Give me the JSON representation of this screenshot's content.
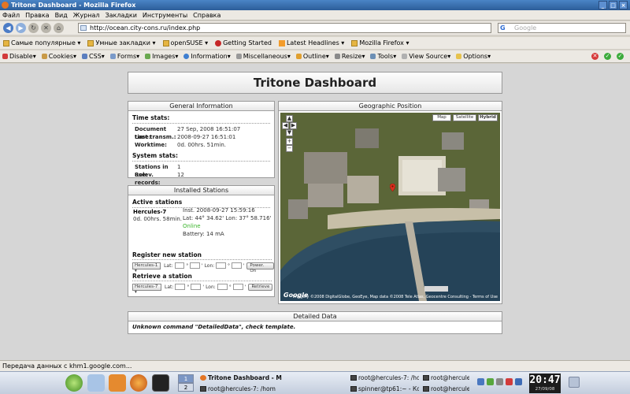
{
  "window": {
    "title": "Tritone Dashboard - Mozilla Firefox"
  },
  "menubar": [
    "Файл",
    "Правка",
    "Вид",
    "Журнал",
    "Закладки",
    "Инструменты",
    "Справка"
  ],
  "navbar": {
    "url": "http://ocean.city-cons.ru/index.php",
    "search_placeholder": "Google"
  },
  "bookmarks": [
    {
      "label": "Самые популярные",
      "icon": "folder-icon"
    },
    {
      "label": "Умные закладки",
      "icon": "folder-icon"
    },
    {
      "label": "openSUSE",
      "icon": "folder-icon"
    },
    {
      "label": "Getting Started",
      "icon": "bookmark-icon"
    },
    {
      "label": "Latest Headlines",
      "icon": "rss-icon"
    },
    {
      "label": "Mozilla Firefox",
      "icon": "folder-icon"
    }
  ],
  "devbar": [
    "Disable",
    "Cookies",
    "CSS",
    "Forms",
    "Images",
    "Information",
    "Miscellaneous",
    "Outline",
    "Resize",
    "Tools",
    "View Source",
    "Options"
  ],
  "page": {
    "title": "Tritone Dashboard",
    "general": {
      "title": "General Information",
      "time_stats": "Time stats:",
      "time_rows": [
        {
          "k": "Document time:",
          "v": "27 Sep, 2008 16:51:07"
        },
        {
          "k": "Last transm.:",
          "v": "2008-09-27 16:51:01"
        },
        {
          "k": "Worktime:",
          "v": "0d. 00hrs. 51min."
        }
      ],
      "system_stats": "System stats:",
      "system_rows": [
        {
          "k": "Stations in use:",
          "v": "1"
        },
        {
          "k": "Relev. records:",
          "v": "12"
        }
      ]
    },
    "stations": {
      "title": "Installed Stations",
      "active_title": "Active stations",
      "name": "Hercules-7",
      "uptime": "0d. 00hrs. 58min.",
      "inst": "Inst. 2008-09-27 15:59:16",
      "latlon": "Lat: 44° 34.62' Lon: 37° 58.716'",
      "status": "Online",
      "battery": "Battery: 14 mA",
      "register_title": "Register new station",
      "register_select": "Hercules-1",
      "register_button": "Power. On",
      "retrieve_title": "Retrieve a station",
      "retrieve_select": "Hercules-7",
      "retrieve_button": "Retrieve",
      "lat_label": "Lat:",
      "lon_label": "Lon:",
      "deg": "°",
      "min": "'"
    },
    "geo": {
      "title": "Geographic Position",
      "map_types": [
        "Map",
        "Satellite",
        "Hybrid"
      ],
      "copyright": "Imagery ©2008 DigitalGlobe, GeoEye, Map data ©2008 Tele Atlas, Geocentre Consulting - Terms of Use",
      "logo": "Google"
    },
    "detail": {
      "title": "Detailed Data",
      "message": "Unknown command \"DetailedData\", check template."
    }
  },
  "statusbar": "Передача данных с khm1.google.com...",
  "taskbar": {
    "tasks_top": [
      "Tritone Dashboard - M",
      "root@hercules-7: /hom",
      "root@hercules-7: /hom",
      "root@hercules-7: /hom"
    ],
    "tasks_bottom": [
      "root@hercules-7: /hom",
      "spinner@tp61:~ - Конс",
      "root@hercules-7: /hom"
    ],
    "pager": [
      "1",
      "2"
    ],
    "clock_time": "20:47",
    "clock_date": "27/09/08"
  }
}
